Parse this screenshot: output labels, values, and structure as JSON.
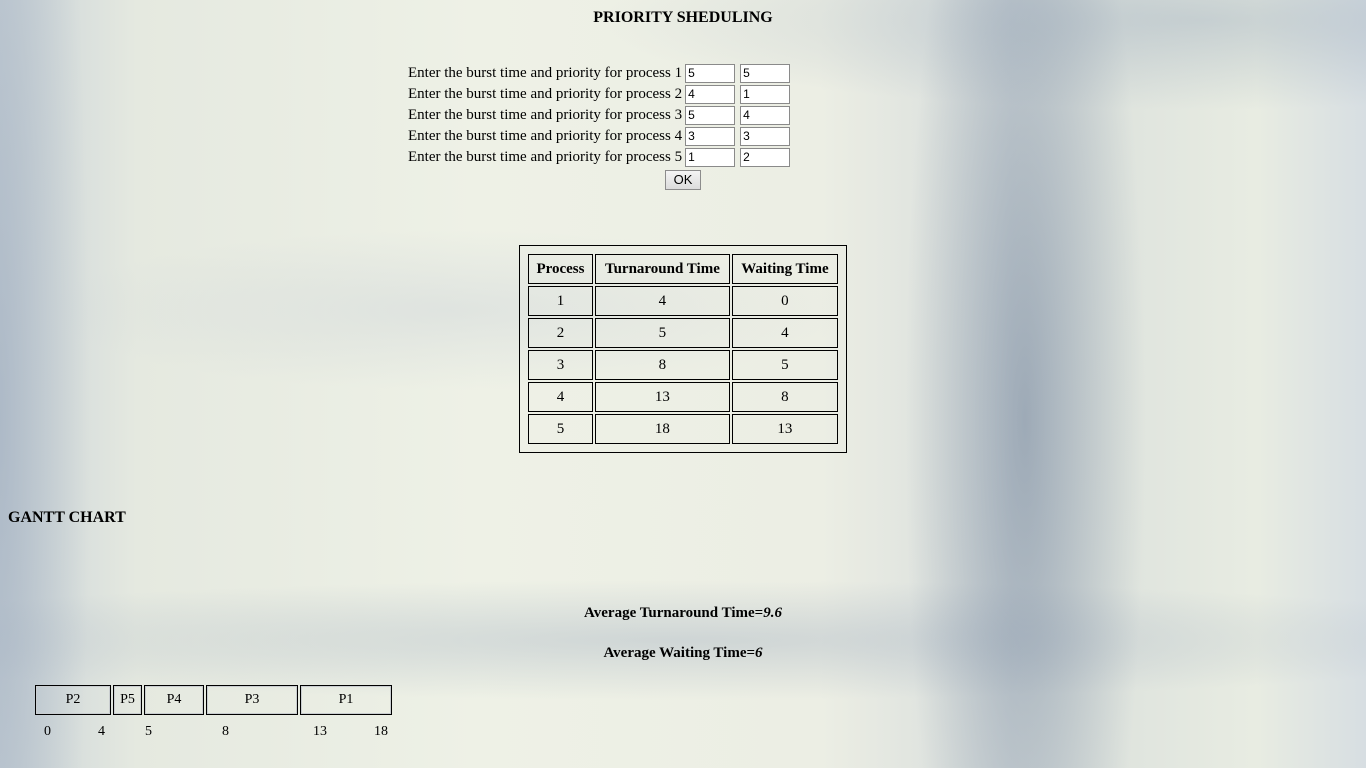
{
  "title": "PRIORITY SHEDULING",
  "form": {
    "rows": [
      {
        "label": "Enter the burst time and priority for process 1",
        "burst": "5",
        "priority": "5"
      },
      {
        "label": "Enter the burst time and priority for process 2",
        "burst": "4",
        "priority": "1"
      },
      {
        "label": "Enter the burst time and priority for process 3",
        "burst": "5",
        "priority": "4"
      },
      {
        "label": "Enter the burst time and priority for process 4",
        "burst": "3",
        "priority": "3"
      },
      {
        "label": "Enter the burst time and priority for process 5",
        "burst": "1",
        "priority": "2"
      }
    ],
    "ok_label": "OK"
  },
  "table": {
    "headers": [
      "Process",
      "Turnaround Time",
      "Waiting Time"
    ],
    "rows": [
      [
        "1",
        "4",
        "0"
      ],
      [
        "2",
        "5",
        "4"
      ],
      [
        "3",
        "8",
        "5"
      ],
      [
        "4",
        "13",
        "8"
      ],
      [
        "5",
        "18",
        "13"
      ]
    ]
  },
  "gantt": {
    "heading": "GANTT CHART",
    "blocks": [
      "P2",
      "P5",
      "P4",
      "P3",
      "P1"
    ],
    "ticks": [
      "0",
      "4",
      "5",
      "8",
      "13",
      "18"
    ]
  },
  "averages": {
    "turnaround_label": "Average Turnaround Time=",
    "turnaround_value": "9.6",
    "waiting_label": "Average Waiting Time=",
    "waiting_value": "6"
  }
}
